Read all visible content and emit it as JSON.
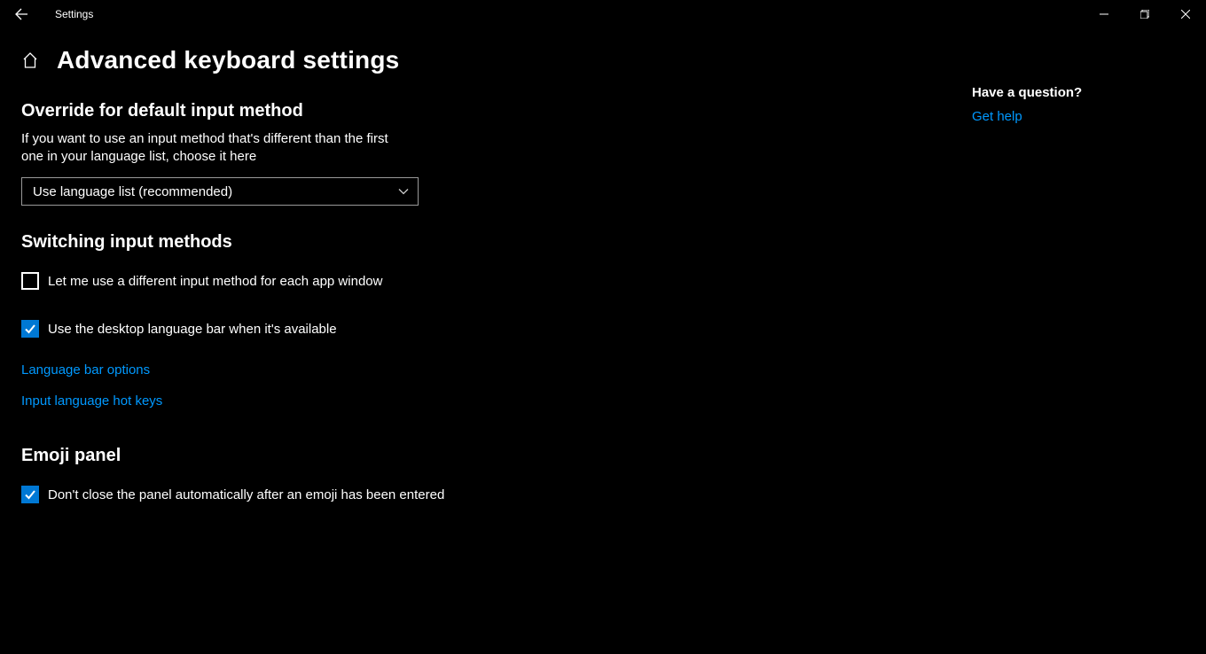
{
  "window": {
    "appTitle": "Settings"
  },
  "page": {
    "title": "Advanced keyboard settings"
  },
  "sections": {
    "override": {
      "heading": "Override for default input method",
      "description": "If you want to use an input method that's different than the first one in your language list, choose it here",
      "dropdownValue": "Use language list (recommended)"
    },
    "switching": {
      "heading": "Switching input methods",
      "checkbox1Label": "Let me use a different input method for each app window",
      "checkbox1Checked": false,
      "checkbox2Label": "Use the desktop language bar when it's available",
      "checkbox2Checked": true,
      "link1": "Language bar options",
      "link2": "Input language hot keys"
    },
    "emoji": {
      "heading": "Emoji panel",
      "checkboxLabel": "Don't close the panel automatically after an emoji has been entered",
      "checkboxChecked": true
    }
  },
  "sidebar": {
    "heading": "Have a question?",
    "link": "Get help"
  }
}
